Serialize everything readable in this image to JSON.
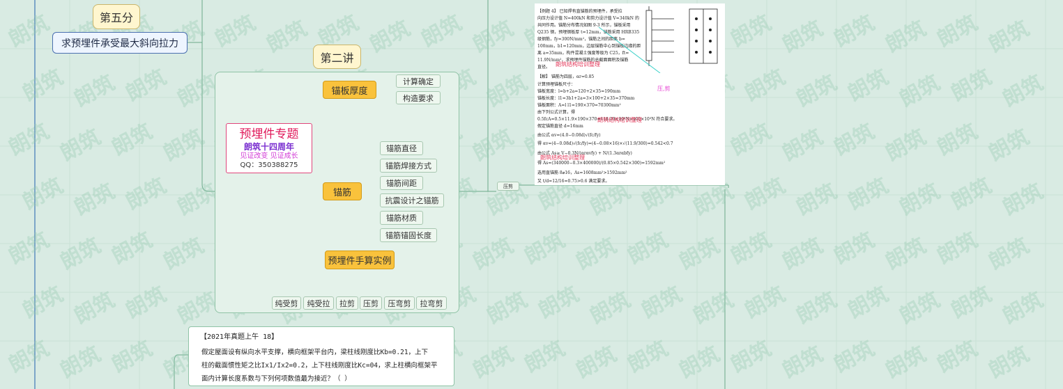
{
  "watermark": "朗筑",
  "section5": {
    "badge": "第五分",
    "topic": "求预埋件承受最大斜向拉力"
  },
  "section2": {
    "badge": "第二讲"
  },
  "center": {
    "title": "预埋件专题",
    "subtitle": "朗筑十四周年",
    "slogan": "见证改变 见证成长",
    "qq": "QQ：350388275"
  },
  "branches": {
    "plate": {
      "label": "锚板厚度",
      "children": [
        "计算确定",
        "构造要求"
      ]
    },
    "rebar": {
      "label": "锚筋",
      "children": [
        "锚筋直径",
        "锚筋焊接方式",
        "锚筋间距",
        "抗震设计之锚筋",
        "锚筋材质",
        "锚筋锚固长度"
      ]
    },
    "example": {
      "label": "预埋件手算实例",
      "children": [
        "纯受剪",
        "纯受拉",
        "拉剪",
        "压剪",
        "压弯剪",
        "拉弯剪"
      ]
    }
  },
  "tag": "压剪",
  "doc": {
    "lines": [
      "【例题 4】  已知焊有直锚筋的预埋件，承受拉",
      "向压力设计值 N=400kN 和剪力设计值 V=340kN 的",
      "共同作用。锚筋分布情况如图 9-3 所示，锚板采用",
      "Q235 钢，预埋钢板厚 t=12mm，锚筋采用 HRB335",
      "级钢筋，fy=300N/mm²，锚筋之间的距离 b=",
      "100mm，b1=120mm，边层锚筋中心到锚板边缘的距",
      "离 a=35mm，构件混凝土强度等级为 C25，ft=",
      "11.9N/mm²，求预埋件锚筋的总截面面积及锚筋",
      "直径。",
      "【解】  锚筋为四层，αr=0.85",
      "   计算预埋锚板尺寸：",
      "   锚板宽度：l=b+2a=120+2×35=190mm",
      "   锚板长度：l1=3b1+2a=3×100+2×35=370mm",
      "   锚板面积：A=l l1=190×370=70300mm²",
      "   由下列公式计算，得",
      "   0.5fcA=0.5×11.9×190×370=418.29×10³N>400×10³N  符合要求。",
      "   假定锚筋直径 d=16mm",
      "   由公式 αv=(4.0−0.08d)√(fc/fy)",
      "   得  αv=(4−0.08d)√(fc/fy)=(4−0.08×16)×√(11.9/300)=0.542<0.7",
      "   由公式 As≥ V−0.3N/(αrαvfy) + N/(1.3αrαbfy)",
      "   得 As=(340000−0.3×400000)/(0.85×0.542×300)=1592mm²",
      "   选用直锚筋 8⌀16，As=1608mm²>1592mm²",
      "   又          t/d=12/16=0.75>0.6      满足要求。"
    ],
    "stamp1": "朗筑结构培训整理",
    "stamp2": "朗筑结构培训整理",
    "stamp3": "朗筑结构培训整理",
    "pink": "压,剪"
  },
  "question": {
    "title": "【2021年真题上午 18】",
    "lines": [
      "假定屋面设有纵向水平支撑，横向框架平台内，梁柱线刚度比Kb=0.21，上下",
      "柱的截面惯性矩之比Ix1/Ix2=0.2，上下柱线刚度比Kc=04，求上柱横向框架平",
      "面内计算长度系数与下列何项数值最为接近？（        ）"
    ]
  }
}
